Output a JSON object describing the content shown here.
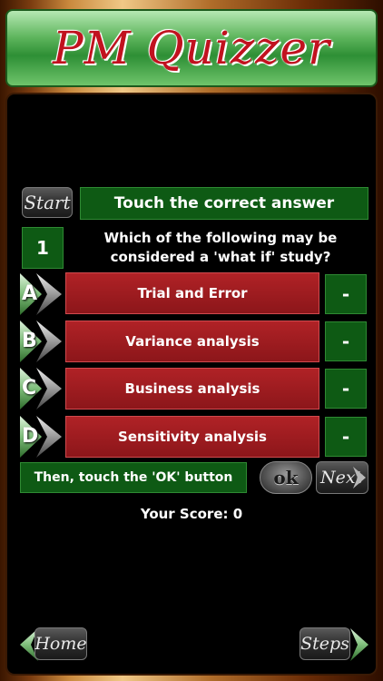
{
  "app": {
    "title": "PM Quizzer"
  },
  "controls": {
    "start_label": "Start",
    "instruction": "Touch the correct answer",
    "ok_instruction": "Then, touch the 'OK' button",
    "ok_label": "ok",
    "next_label": "Next",
    "home_label": "Home",
    "steps_label": "Steps"
  },
  "question": {
    "number": "1",
    "text": "Which of the following may be considered a 'what if' study?"
  },
  "answers": [
    {
      "letter": "A",
      "text": "Trial and Error",
      "result": "-"
    },
    {
      "letter": "B",
      "text": "Variance analysis",
      "result": "-"
    },
    {
      "letter": "C",
      "text": "Business analysis",
      "result": "-"
    },
    {
      "letter": "D",
      "text": "Sensitivity analysis",
      "result": "-"
    }
  ],
  "score": {
    "label": "Your Score: 0"
  },
  "colors": {
    "answer_red": "#a51c20",
    "green": "#0e5a14",
    "title_red": "#c1121f"
  }
}
